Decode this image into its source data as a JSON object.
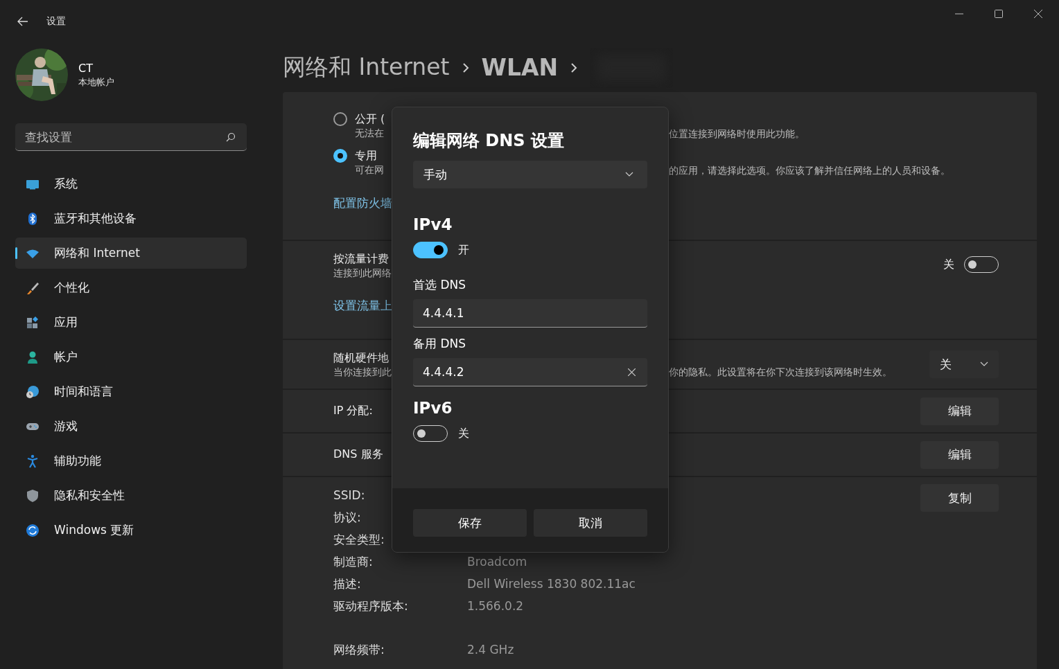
{
  "window": {
    "title": "设置"
  },
  "user": {
    "name": "CT",
    "account_type": "本地帐户"
  },
  "search": {
    "placeholder": "查找设置"
  },
  "nav": [
    {
      "label": "系统",
      "selected": false
    },
    {
      "label": "蓝牙和其他设备",
      "selected": false
    },
    {
      "label": "网络和 Internet",
      "selected": true
    },
    {
      "label": "个性化",
      "selected": false
    },
    {
      "label": "应用",
      "selected": false
    },
    {
      "label": "帐户",
      "selected": false
    },
    {
      "label": "时间和语言",
      "selected": false
    },
    {
      "label": "游戏",
      "selected": false
    },
    {
      "label": "辅助功能",
      "selected": false
    },
    {
      "label": "隐私和安全性",
      "selected": false
    },
    {
      "label": "Windows 更新",
      "selected": false
    }
  ],
  "breadcrumb": [
    {
      "label": "网络和 Internet"
    },
    {
      "label": "WLAN"
    }
  ],
  "network_profile": {
    "options": [
      {
        "label": "公开 (",
        "description_start": "无法在",
        "description_end": "位置连接到网络时使用此功能。",
        "selected": false
      },
      {
        "label": "专用",
        "description_start": "可在网",
        "description_end": "的应用，请选择此选项。你应该了解并信任网络上的人员和设备。",
        "selected": true
      }
    ],
    "firewall_link": "配置防火墙"
  },
  "metered": {
    "title": "按流量计费",
    "description": "连接到此网络",
    "link": "设置流量上",
    "state_label": "关",
    "on": false
  },
  "random_hardware": {
    "title": "随机硬件地",
    "description_start": "当你连接到此",
    "description_end": "你的隐私。此设置将在你下次连接到该网络时生效。",
    "value": "关"
  },
  "ip_assignment": {
    "label": "IP 分配:",
    "button": "编辑"
  },
  "dns_server": {
    "label": "DNS 服务",
    "button": "编辑"
  },
  "properties": {
    "copy_button": "复制",
    "rows": [
      {
        "label": "SSID:"
      },
      {
        "label": "协议:"
      },
      {
        "label": "安全类型:"
      },
      {
        "label": "制造商:",
        "value": "Broadcom"
      },
      {
        "label": "描述:",
        "value": "Dell Wireless 1830 802.11ac"
      },
      {
        "label": "驱动程序版本:",
        "value": "1.566.0.2"
      }
    ],
    "band_rows": [
      {
        "label": "网络频带:",
        "value": "2.4 GHz"
      }
    ]
  },
  "dialog": {
    "title": "编辑网络 DNS 设置",
    "mode": "手动",
    "ipv4": {
      "heading": "IPv4",
      "on": true,
      "state_label": "开",
      "preferred_label": "首选 DNS",
      "preferred_value": "4.4.4.1",
      "alternate_label": "备用 DNS",
      "alternate_value": "4.4.4.2"
    },
    "ipv6": {
      "heading": "IPv6",
      "on": false,
      "state_label": "关"
    },
    "buttons": [
      {
        "label": "保存"
      },
      {
        "label": "取消"
      }
    ]
  }
}
